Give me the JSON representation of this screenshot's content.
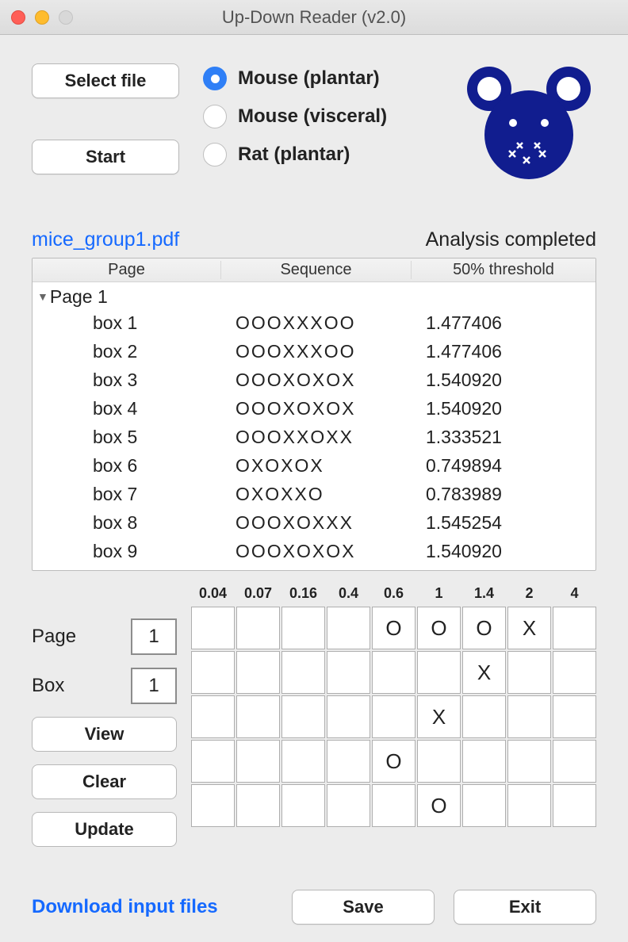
{
  "window": {
    "title": "Up-Down Reader (v2.0)"
  },
  "toolbar": {
    "select_file": "Select file",
    "start": "Start"
  },
  "radios": {
    "options": [
      {
        "label": "Mouse (plantar)",
        "selected": true
      },
      {
        "label": "Mouse (visceral)",
        "selected": false
      },
      {
        "label": "Rat (plantar)",
        "selected": false
      }
    ]
  },
  "file": {
    "name": "mice_group1.pdf"
  },
  "status": "Analysis completed",
  "table": {
    "headers": {
      "page": "Page",
      "sequence": "Sequence",
      "threshold": "50% threshold"
    },
    "group": "Page 1",
    "rows": [
      {
        "box": "box 1",
        "seq": "OOOXXXOO",
        "thr": "1.477406"
      },
      {
        "box": "box 2",
        "seq": "OOOXXXOO",
        "thr": "1.477406"
      },
      {
        "box": "box 3",
        "seq": "OOOXOXOX",
        "thr": "1.540920"
      },
      {
        "box": "box 4",
        "seq": "OOOXOXOX",
        "thr": "1.540920"
      },
      {
        "box": "box 5",
        "seq": "OOOXXOXX",
        "thr": "1.333521"
      },
      {
        "box": "box 6",
        "seq": "OXOXOX",
        "thr": "0.749894"
      },
      {
        "box": "box 7",
        "seq": "OXOXXO",
        "thr": "0.783989"
      },
      {
        "box": "box 8",
        "seq": "OOOXOXXX",
        "thr": "1.545254"
      },
      {
        "box": "box 9",
        "seq": "OOOXOXOX",
        "thr": "1.540920"
      }
    ]
  },
  "editor": {
    "page_label": "Page",
    "page_value": "1",
    "box_label": "Box",
    "box_value": "1",
    "view": "View",
    "clear": "Clear",
    "update": "Update"
  },
  "grid": {
    "columns": [
      "0.04",
      "0.07",
      "0.16",
      "0.4",
      "0.6",
      "1",
      "1.4",
      "2",
      "4"
    ],
    "cells": [
      [
        "",
        "",
        "",
        "",
        "O",
        "O",
        "O",
        "X",
        ""
      ],
      [
        "",
        "",
        "",
        "",
        "",
        "",
        "X",
        "",
        ""
      ],
      [
        "",
        "",
        "",
        "",
        "",
        "X",
        "",
        "",
        ""
      ],
      [
        "",
        "",
        "",
        "",
        "O",
        "",
        "",
        "",
        ""
      ],
      [
        "",
        "",
        "",
        "",
        "",
        "O",
        "",
        "",
        ""
      ]
    ]
  },
  "footer": {
    "download": "Download input files",
    "save": "Save",
    "exit": "Exit"
  }
}
